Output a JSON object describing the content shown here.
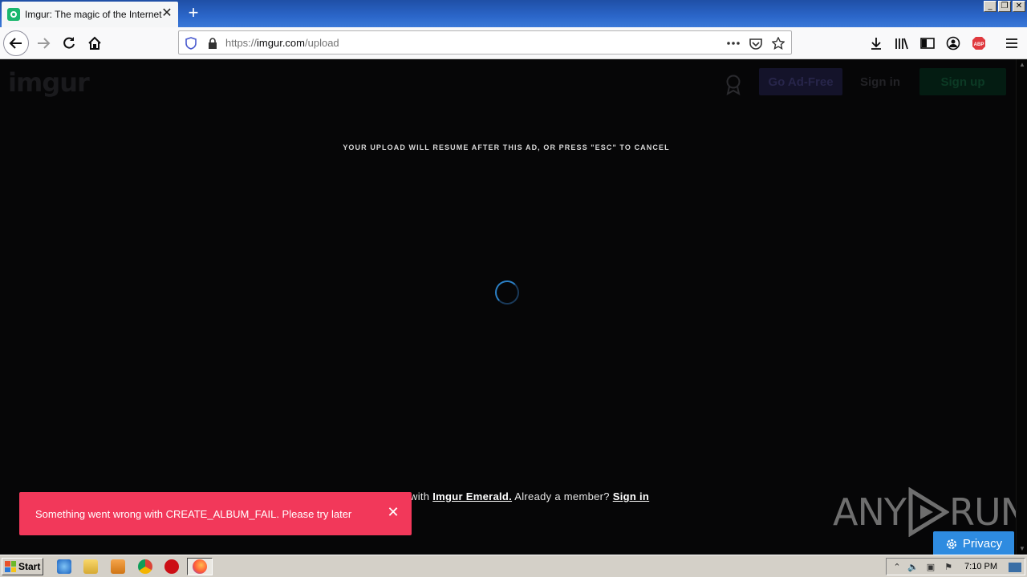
{
  "browser": {
    "tab_title": "Imgur: The magic of the Internet",
    "url_prefix": "https://",
    "url_host": "imgur.com",
    "url_path": "/upload",
    "new_tab_label": "+",
    "window_buttons": [
      "_",
      "❐",
      "✕"
    ]
  },
  "page": {
    "logo": "imgur",
    "buttons": {
      "ad_free": "Go Ad-Free",
      "sign_in": "Sign in",
      "sign_up": "Sign up"
    },
    "ad_notice": "YOUR UPLOAD WILL RESUME AFTER THIS AD, OR PRESS \"ESC\" TO CANCEL",
    "bottom": {
      "prefix": "with ",
      "emerald_link": "Imgur Emerald.",
      "middle": " Already a member? ",
      "sign_in_link": "Sign in"
    },
    "toast": {
      "message": "Something went wrong with CREATE_ALBUM_FAIL. Please try later",
      "close": "✕"
    },
    "watermark": {
      "left": "ANY",
      "right": "RUN"
    },
    "privacy_label": "Privacy"
  },
  "taskbar": {
    "start_label": "Start",
    "clock": "7:10 PM"
  },
  "colors": {
    "toast": "#f2385a",
    "privacy": "#2e8be0",
    "page_bg": "#060607"
  }
}
